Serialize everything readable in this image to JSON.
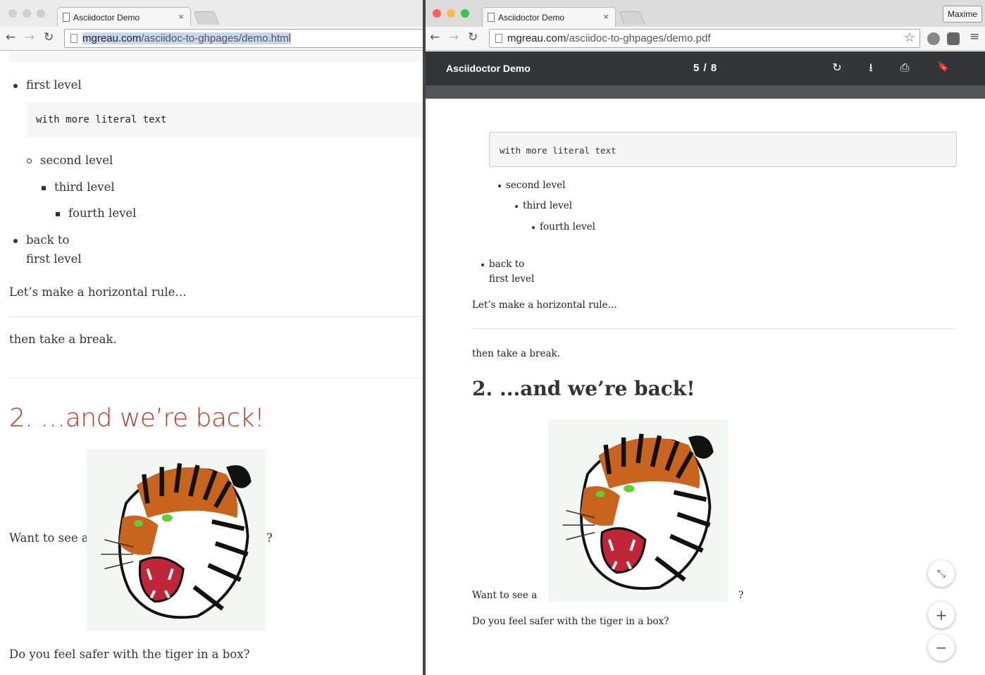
{
  "left_window": {
    "tab": {
      "title": "Asciidoctor Demo",
      "close": "×"
    },
    "url": {
      "host": "mgreau.com",
      "path": "/asciidoc-to-ghpages/demo.html"
    },
    "nav": {
      "back": "←",
      "forward": "→",
      "reload": "↻"
    },
    "content": {
      "first_level": "first level",
      "literal": "with more literal text",
      "second_level": "second level",
      "third_level": "third level",
      "fourth_level": "fourth level",
      "back_to": "back to",
      "back_first_level": "first level",
      "hr_intro": "Let’s make a horizontal rule…",
      "break": "then take a break.",
      "heading": "2. …and we’re back!",
      "want_to_see": "Want to see a",
      "question_mark": "?",
      "safer": "Do you feel safer with the tiger in a box?"
    }
  },
  "right_window": {
    "tab": {
      "title": "Asciidoctor Demo",
      "close": "×"
    },
    "url": {
      "host": "mgreau.com",
      "path": "/asciidoc-to-ghpages/demo.pdf"
    },
    "nav": {
      "back": "←",
      "forward": "→",
      "reload": "↻"
    },
    "star": "☆",
    "profile": "Maxime",
    "menu": "≡",
    "pdf_toolbar": {
      "title": "Asciidoctor Demo",
      "page_indicator": "5 / 8",
      "rotate_icon": "↻",
      "download_icon": "⭳",
      "print_icon": "⎙",
      "bookmark_icon": "🔖"
    },
    "page": {
      "literal": "with more literal text",
      "second_level": "second level",
      "third_level": "third level",
      "fourth_level": "fourth level",
      "back_to": "back to",
      "back_first_level": "first level",
      "hr_intro": "Let’s make a horizontal rule...",
      "break": "then take a break.",
      "heading": "2. ...and we’re back!",
      "want_to_see": "Want to see a",
      "question_mark": "?",
      "safer": "Do you feel safer with the tiger in a box?"
    },
    "fab": {
      "fit": "⤡",
      "zoom_in": "+",
      "zoom_out": "−"
    }
  },
  "colors": {
    "heading_red": "#ba3925",
    "pdf_toolbar": "#323639",
    "traffic_red": "#fc605b",
    "traffic_yellow": "#fdbc40",
    "traffic_green": "#34c84a"
  }
}
